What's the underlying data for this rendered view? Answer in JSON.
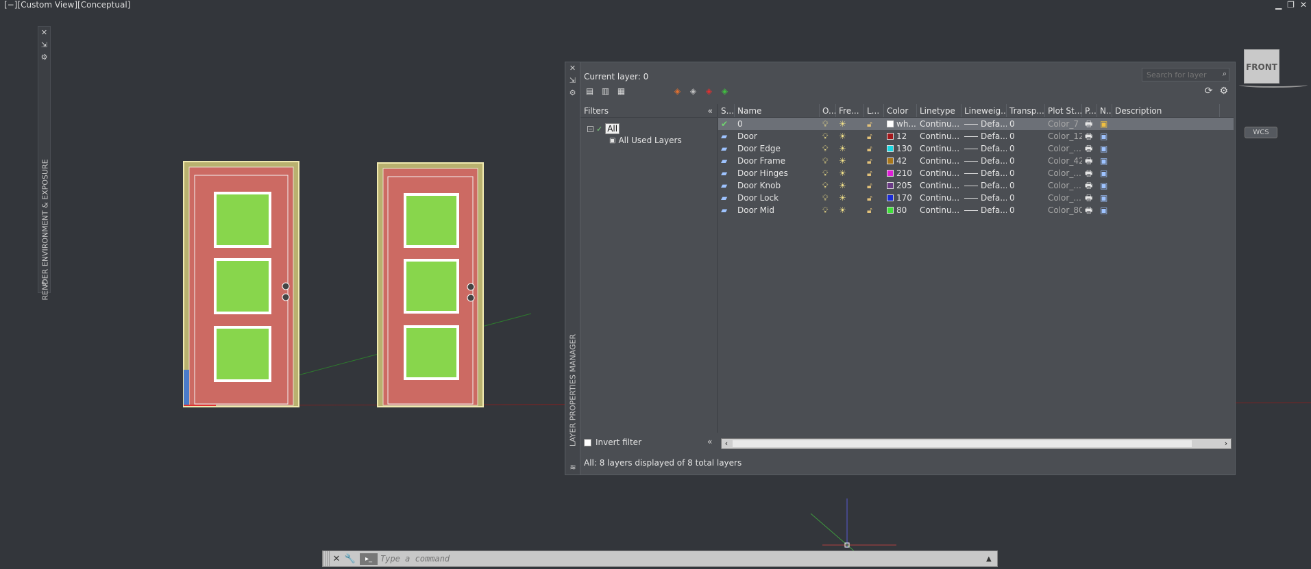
{
  "viewport": {
    "label": "[−][Custom View][Conceptual]",
    "window_controls": [
      "▁",
      "❐",
      "✕"
    ]
  },
  "left_palette": {
    "title": "RENDER ENVIRONMENT & EXPOSURE"
  },
  "layer_manager": {
    "side_title": "LAYER PROPERTIES MANAGER",
    "current_layer": "Current layer: 0",
    "search_placeholder": "Search for layer",
    "filters_label": "Filters",
    "tree_all": "All",
    "tree_used": "All Used Layers",
    "invert_filter": "Invert filter",
    "status": "All: 8 layers displayed of 8 total layers",
    "columns": [
      "S...",
      "Name",
      "O...",
      "Fre...",
      "L...",
      "Color",
      "Linetype",
      "Lineweig...",
      "Transp...",
      "Plot St...",
      "P...",
      "N...",
      "Description"
    ],
    "rows": [
      {
        "name": "0",
        "color_name": "wh...",
        "color_hex": "#ffffff",
        "linetype": "Continu...",
        "lineweight": "Defa...",
        "transp": "0",
        "plot": "Color_7",
        "selected": true
      },
      {
        "name": "Door",
        "color_name": "12",
        "color_hex": "#a3171b",
        "linetype": "Continu...",
        "lineweight": "Defa...",
        "transp": "0",
        "plot": "Color_12"
      },
      {
        "name": "Door Edge",
        "color_name": "130",
        "color_hex": "#18d6e0",
        "linetype": "Continu...",
        "lineweight": "Defa...",
        "transp": "0",
        "plot": "Color_..."
      },
      {
        "name": "Door Frame",
        "color_name": "42",
        "color_hex": "#a7761a",
        "linetype": "Continu...",
        "lineweight": "Defa...",
        "transp": "0",
        "plot": "Color_42"
      },
      {
        "name": "Door Hinges",
        "color_name": "210",
        "color_hex": "#e01dd8",
        "linetype": "Continu...",
        "lineweight": "Defa...",
        "transp": "0",
        "plot": "Color_..."
      },
      {
        "name": "Door Knob",
        "color_name": "205",
        "color_hex": "#6a3a85",
        "linetype": "Continu...",
        "lineweight": "Defa...",
        "transp": "0",
        "plot": "Color_..."
      },
      {
        "name": "Door Lock",
        "color_name": "170",
        "color_hex": "#1a2bd6",
        "linetype": "Continu...",
        "lineweight": "Defa...",
        "transp": "0",
        "plot": "Color_..."
      },
      {
        "name": "Door Mid",
        "color_name": "80",
        "color_hex": "#3fe03a",
        "linetype": "Continu...",
        "lineweight": "Defa...",
        "transp": "0",
        "plot": "Color_80"
      }
    ]
  },
  "view_cube": {
    "face": "FRONT",
    "wcs": "WCS"
  },
  "command_line": {
    "placeholder": "Type a command"
  }
}
